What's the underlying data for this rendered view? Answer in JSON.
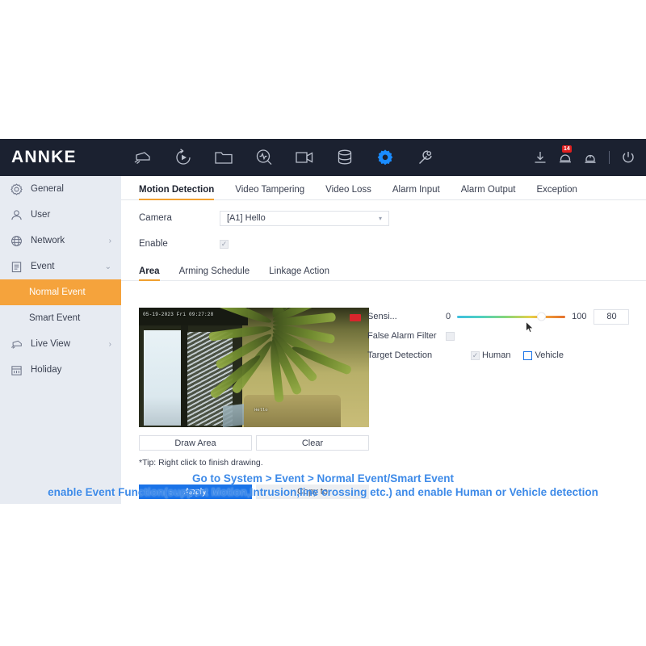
{
  "app": {
    "brand": "ANNKE",
    "toolbar_icons": [
      {
        "name": "camera-icon",
        "label": "Camera"
      },
      {
        "name": "playback-icon",
        "label": "Playback"
      },
      {
        "name": "file-folder-icon",
        "label": "File"
      },
      {
        "name": "smart-search-icon",
        "label": "Smart Search"
      },
      {
        "name": "video-channel-icon",
        "label": "Channel"
      },
      {
        "name": "storage-icon",
        "label": "Storage"
      },
      {
        "name": "gear-icon",
        "label": "System"
      },
      {
        "name": "wrench-icon",
        "label": "Maintenance"
      }
    ],
    "toolbar_right": [
      {
        "name": "download-icon",
        "label": "Download"
      },
      {
        "name": "alarm-bell-icon",
        "label": "Alarm",
        "badge": "14"
      },
      {
        "name": "siren-icon",
        "label": "Alert"
      },
      {
        "name": "power-icon",
        "label": "Power"
      }
    ]
  },
  "sidebar": {
    "items": [
      {
        "label": "General",
        "icon": "gear-icon",
        "chevron": "",
        "selected": false,
        "sub": false
      },
      {
        "label": "User",
        "icon": "user-icon",
        "chevron": "",
        "selected": false,
        "sub": false
      },
      {
        "label": "Network",
        "icon": "globe-icon",
        "chevron": "›",
        "selected": false,
        "sub": false
      },
      {
        "label": "Event",
        "icon": "clipboard-icon",
        "chevron": "⌄",
        "selected": false,
        "sub": false
      },
      {
        "label": "Normal Event",
        "icon": "",
        "chevron": "",
        "selected": true,
        "sub": true
      },
      {
        "label": "Smart Event",
        "icon": "",
        "chevron": "",
        "selected": false,
        "sub": true
      },
      {
        "label": "Live View",
        "icon": "camera-icon",
        "chevron": "›",
        "selected": false,
        "sub": false
      },
      {
        "label": "Holiday",
        "icon": "calendar-icon",
        "chevron": "",
        "selected": false,
        "sub": false
      }
    ]
  },
  "main": {
    "tabs": [
      {
        "label": "Motion Detection",
        "active": true
      },
      {
        "label": "Video Tampering",
        "active": false
      },
      {
        "label": "Video Loss",
        "active": false
      },
      {
        "label": "Alarm Input",
        "active": false
      },
      {
        "label": "Alarm Output",
        "active": false
      },
      {
        "label": "Exception",
        "active": false
      }
    ],
    "camera_label": "Camera",
    "camera_value": "[A1] Hello",
    "camera_caret": "▾",
    "enable_label": "Enable",
    "enable_checked": true,
    "subtabs": [
      {
        "label": "Area",
        "active": true
      },
      {
        "label": "Arming Schedule",
        "active": false
      },
      {
        "label": "Linkage Action",
        "active": false
      }
    ],
    "video": {
      "timestamp": "05-19-2023 Fri 09:27:28",
      "overlay_text": "Hello",
      "rec_badge": "REC"
    },
    "draw_area_button": "Draw Area",
    "clear_button": "Clear",
    "tip": "*Tip: Right click to finish drawing.",
    "apply_button": "Apply",
    "copy_to_button": "Copy to",
    "settings": {
      "sensitivity_label": "Sensi...",
      "sensitivity_min": "0",
      "sensitivity_max": "100",
      "sensitivity_value": "80",
      "false_alarm_label": "False Alarm Filter",
      "false_alarm_checked": false,
      "target_detection_label": "Target Detection",
      "targets": [
        {
          "label": "Human",
          "checked": true,
          "highlighted": false
        },
        {
          "label": "Vehicle",
          "checked": false,
          "highlighted": true
        }
      ]
    }
  },
  "caption": {
    "line1": "Go to System > Event > Normal Event/Smart Event",
    "line2": "enable Event Function(support Motion,Intrusion,line crossing etc.) and enable Human or Vehicle detection"
  },
  "colors": {
    "navbar": "#1b2130",
    "sidebar": "#e7ebf2",
    "accent_orange": "#f5a33c",
    "accent_blue": "#1a73e8",
    "caption_blue": "#3d8ae8",
    "active_icon": "#1a8cff",
    "badge_red": "#e02020"
  }
}
